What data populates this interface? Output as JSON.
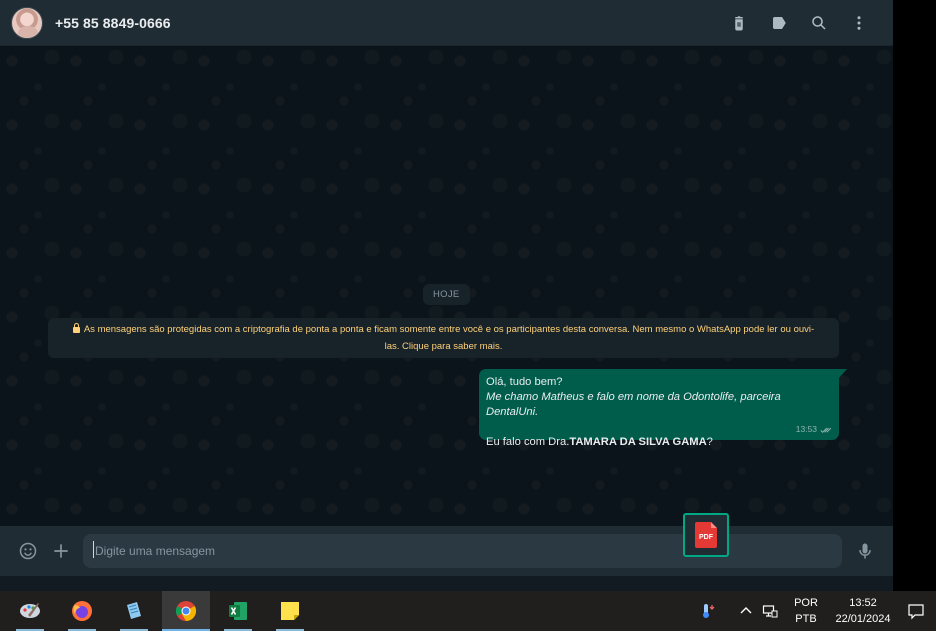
{
  "header": {
    "contact_name": "+55 85 8849-0666",
    "actions": [
      "delete-icon",
      "label-icon",
      "search-icon",
      "more-icon"
    ]
  },
  "chat": {
    "date_chip": "HOJE",
    "encryption_notice": "As mensagens são protegidas com a criptografia de ponta a ponta e ficam somente entre você e os participantes desta conversa. Nem mesmo o WhatsApp pode ler ou ouvi-las. Clique para saber mais.",
    "message": {
      "line1": "Olá, tudo bem?",
      "line2": "Me chamo Matheus e falo em nome da Odontolife, parceira DentalUni.",
      "line3_prefix": "Eu falo com Dra.",
      "line3_bold": "TAMARA DA SILVA GAMA",
      "line3_suffix": "?",
      "time": "13:53",
      "status": "delivered"
    }
  },
  "compose": {
    "placeholder": "Digite uma mensagem",
    "value": "",
    "attachment_label": "PDF"
  },
  "taskbar": {
    "apps": [
      "paint-icon",
      "firefox-icon",
      "notepad-icon",
      "chrome-icon",
      "excel-icon",
      "sticky-notes-icon"
    ],
    "active_app": "chrome-icon",
    "language_line1": "POR",
    "language_line2": "PTB",
    "time": "13:52",
    "date": "22/01/2024"
  },
  "colors": {
    "header_bg": "#202c33",
    "chat_bg": "#0b141a",
    "outgoing_bubble": "#005c4b",
    "notice_text": "#ffd279",
    "accent": "#00a884"
  }
}
